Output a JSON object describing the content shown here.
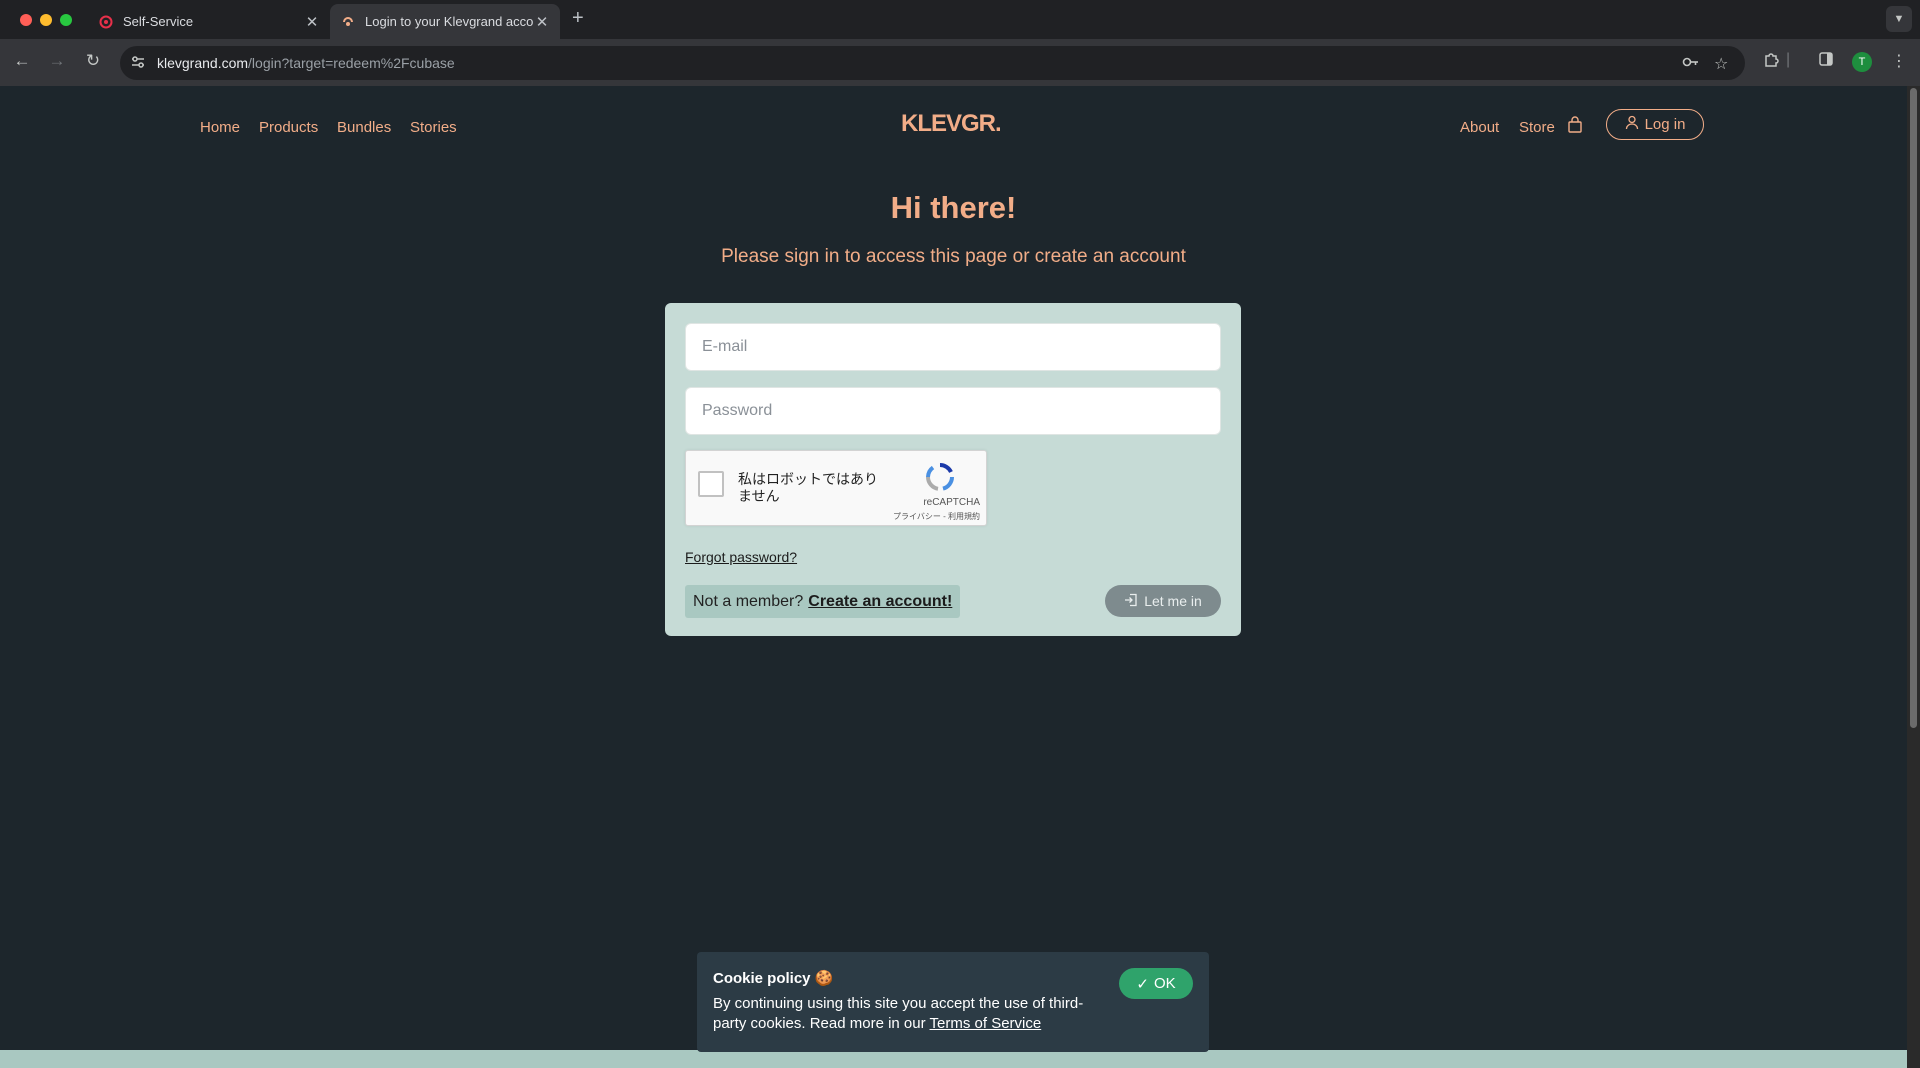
{
  "browser": {
    "tabs": [
      {
        "title": "Self-Service",
        "favicon": "self-service-favicon"
      },
      {
        "title": "Login to your Klevgrand account",
        "favicon": "klevgrand-favicon",
        "active": true
      }
    ],
    "url_domain": "klevgrand.com",
    "url_path": "/login?target=redeem%2Fcubase",
    "profile_initial": "T"
  },
  "site": {
    "nav_left": [
      "Home",
      "Products",
      "Bundles",
      "Stories"
    ],
    "logo": "KLEVGR.",
    "nav_right": [
      "About",
      "Store"
    ],
    "login_label": "Log in",
    "headline": "Hi there!",
    "subline": "Please sign in to access this page or create an account",
    "form": {
      "email_placeholder": "E-mail",
      "password_placeholder": "Password",
      "captcha_label": "私はロボットではありません",
      "captcha_brand": "reCAPTCHA",
      "captcha_links": "プライバシー - 利用規約",
      "forgot": "Forgot password?",
      "not_member": "Not a member?",
      "create_account": "Create an account!",
      "submit": "Let me in"
    },
    "cookie": {
      "title": "Cookie policy",
      "emoji": "🍪",
      "text": "By continuing using this site you accept the use of third-party cookies. Read more in our",
      "link": "Terms of Service",
      "ok": "OK"
    }
  },
  "colors": {
    "accent": "#f2ad88",
    "background": "#1d262c",
    "card": "#c6dbd6",
    "ok_button": "#2fa36b"
  }
}
